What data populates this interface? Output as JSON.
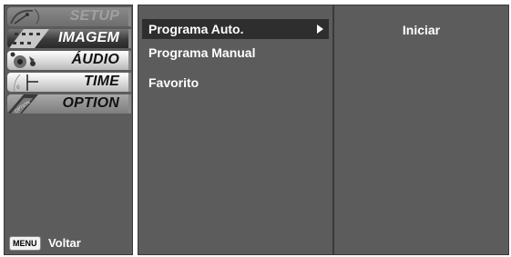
{
  "sidebar": {
    "tabs": [
      {
        "id": "setup",
        "label": "SETUP",
        "icon": "satellite-dish-icon"
      },
      {
        "id": "imagem",
        "label": "IMAGEM",
        "icon": "film-strip-icon"
      },
      {
        "id": "audio",
        "label": "ÁUDIO",
        "icon": "speaker-icon"
      },
      {
        "id": "time",
        "label": "TIME",
        "icon": "clock-icon"
      },
      {
        "id": "option",
        "label": "OPTION",
        "icon": "option-icon"
      }
    ],
    "back": {
      "key": "MENU",
      "label": "Voltar"
    }
  },
  "list": {
    "items": [
      {
        "label": "Programa Auto.",
        "selected": true
      },
      {
        "label": "Programa Manual",
        "selected": false
      },
      {
        "label": "Favorito",
        "selected": false
      }
    ]
  },
  "detail": {
    "action_label": "Iniciar"
  },
  "colors": {
    "panel": "#5c5c5c",
    "highlight": "#2e2e2e",
    "text": "#ffffff"
  }
}
